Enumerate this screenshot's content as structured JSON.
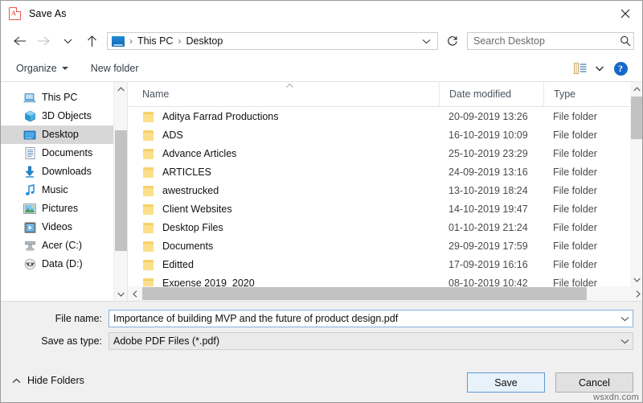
{
  "window": {
    "title": "Save As",
    "app_icon": "pdf-file-icon",
    "close_label": "✕"
  },
  "nav": {
    "back": "back-arrow",
    "forward": "forward-arrow",
    "recent": "recent-locations-chevron",
    "up": "up-arrow",
    "refresh": "refresh-icon",
    "breadcrumbs": [
      "This PC",
      "Desktop"
    ],
    "breadcrumb_separator": "›",
    "address_dropdown": "chevron-down-icon"
  },
  "search": {
    "placeholder": "Search Desktop",
    "value": "",
    "icon": "search-icon"
  },
  "command_bar": {
    "organize_label": "Organize",
    "new_folder_label": "New folder",
    "view_icon": "view-layout-icon",
    "view_caret": "chevron-down-icon",
    "help_icon": "help-icon",
    "help_glyph": "?"
  },
  "sidebar": {
    "items": [
      {
        "label": "This PC",
        "icon": "this-pc-icon",
        "selected": false
      },
      {
        "label": "3D Objects",
        "icon": "3d-objects-icon",
        "selected": false
      },
      {
        "label": "Desktop",
        "icon": "desktop-icon",
        "selected": true
      },
      {
        "label": "Documents",
        "icon": "documents-icon",
        "selected": false
      },
      {
        "label": "Downloads",
        "icon": "downloads-icon",
        "selected": false
      },
      {
        "label": "Music",
        "icon": "music-icon",
        "selected": false
      },
      {
        "label": "Pictures",
        "icon": "pictures-icon",
        "selected": false
      },
      {
        "label": "Videos",
        "icon": "videos-icon",
        "selected": false
      },
      {
        "label": "Acer (C:)",
        "icon": "drive-icon",
        "selected": false
      },
      {
        "label": "Data (D:)",
        "icon": "drive-icon",
        "selected": false
      }
    ]
  },
  "file_list": {
    "columns": [
      "Name",
      "Date modified",
      "Type"
    ],
    "sort_column": "Name",
    "sort_direction": "ascending",
    "sort_indicator": "˄",
    "rows": [
      {
        "name": "Aditya Farrad Productions",
        "date": "20-09-2019 13:26",
        "type": "File folder"
      },
      {
        "name": "ADS",
        "date": "16-10-2019 10:09",
        "type": "File folder"
      },
      {
        "name": "Advance Articles",
        "date": "25-10-2019 23:29",
        "type": "File folder"
      },
      {
        "name": "ARTICLES",
        "date": "24-09-2019 13:16",
        "type": "File folder"
      },
      {
        "name": "awestrucked",
        "date": "13-10-2019 18:24",
        "type": "File folder"
      },
      {
        "name": "Client Websites",
        "date": "14-10-2019 19:47",
        "type": "File folder"
      },
      {
        "name": "Desktop Files",
        "date": "01-10-2019 21:24",
        "type": "File folder"
      },
      {
        "name": "Documents",
        "date": "29-09-2019 17:59",
        "type": "File folder"
      },
      {
        "name": "Editted",
        "date": "17-09-2019 16:16",
        "type": "File folder"
      },
      {
        "name": "Expense 2019_2020",
        "date": "08-10-2019 10:42",
        "type": "File folder"
      }
    ]
  },
  "form": {
    "file_name_label": "File name:",
    "file_name_value": "Importance of building MVP and the future of product design.pdf",
    "save_as_type_label": "Save as type:",
    "save_as_type_value": "Adobe PDF Files (*.pdf)",
    "dropdown_icon": "chevron-down-icon"
  },
  "footer": {
    "hide_folders_label": "Hide Folders",
    "hide_folders_icon": "chevron-up-icon",
    "save_label": "Save",
    "cancel_label": "Cancel"
  },
  "watermark": "wsxdn.com",
  "colors": {
    "accent": "#1569c7",
    "focus_border": "#7fb2de",
    "folder": "#fcdf8a",
    "selection": "#d7d7d7",
    "pdf_red": "#e8554d"
  }
}
